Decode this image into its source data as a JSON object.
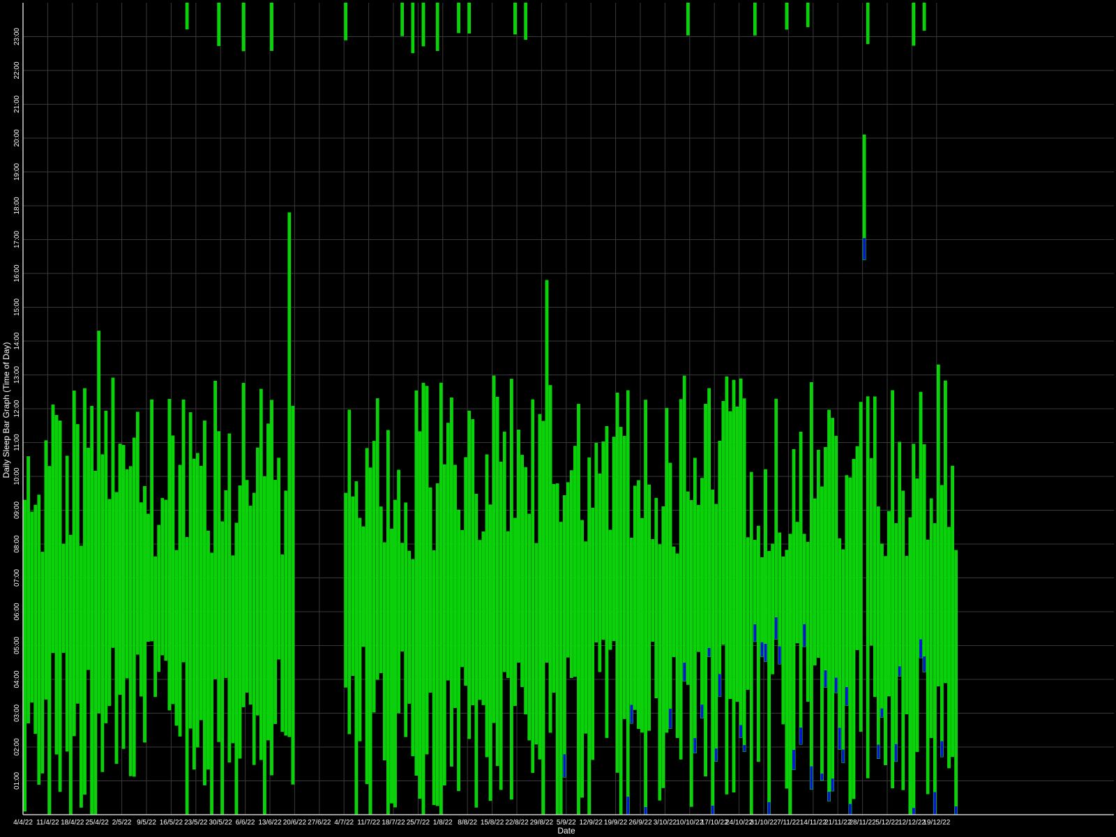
{
  "chart_data": {
    "type": "bar",
    "subtype": "floating-range (sleep intervals per day)",
    "xlabel": "Date",
    "ylabel": "Daily Sleep Bar Graph (Time of Day)",
    "y_unit": "hour of day",
    "ylim": [
      0,
      24
    ],
    "y_ticks": [
      "01:00",
      "02:00",
      "03:00",
      "04:00",
      "05:00",
      "06:00",
      "07:00",
      "08:00",
      "09:00",
      "10:00",
      "11:00",
      "12:00",
      "13:00",
      "14:00",
      "15:00",
      "16:00",
      "17:00",
      "18:00",
      "19:00",
      "20:00",
      "21:00",
      "22:00",
      "23:00"
    ],
    "x_ticks": [
      "4/4/22",
      "11/4/22",
      "18/4/22",
      "25/4/22",
      "2/5/22",
      "9/5/22",
      "16/5/22",
      "23/5/22",
      "30/5/22",
      "6/6/22",
      "13/6/22",
      "20/6/22",
      "27/6/22",
      "4/7/22",
      "11/7/22",
      "18/7/22",
      "25/7/22",
      "1/8/22",
      "8/8/22",
      "15/8/22",
      "22/8/22",
      "29/8/22",
      "5/9/22",
      "12/9/22",
      "19/9/22",
      "26/9/22",
      "3/10/22",
      "10/10/22",
      "17/10/22",
      "24/10/22",
      "31/10/22",
      "7/11/22",
      "14/11/22",
      "21/11/22",
      "28/11/22",
      "5/12/22",
      "12/12/22",
      "19/12/22"
    ],
    "first_date": "2022-04-04",
    "last_date": "2022-12-24",
    "grid": true,
    "background": "#000000",
    "colors": {
      "sleep": "#0bd10b",
      "sleep_edge": "#00ff00",
      "secondary": "#0a14d6",
      "grid": "#3a3a3a"
    },
    "series_note": "Each daily bar spans from sleep start to sleep end (hours of day). Green = sleep segment, blue = secondary segment at bar ends.",
    "sample_bars": [
      {
        "date": "2022-04-04",
        "start": 0.1,
        "end": 9.3
      },
      {
        "date": "2022-04-11",
        "start": 0.0,
        "end": 10.3
      },
      {
        "date": "2022-04-25",
        "start": 3.0,
        "end": 14.3
      },
      {
        "date": "2022-06-18",
        "start": 2.3,
        "end": 17.8
      },
      {
        "date": "2022-08-30",
        "start": 4.5,
        "end": 15.8
      },
      {
        "date": "2022-11-28",
        "start": 16.4,
        "end": 20.1
      },
      {
        "date": "2022-12-19",
        "start": 3.8,
        "end": 13.3
      }
    ]
  }
}
